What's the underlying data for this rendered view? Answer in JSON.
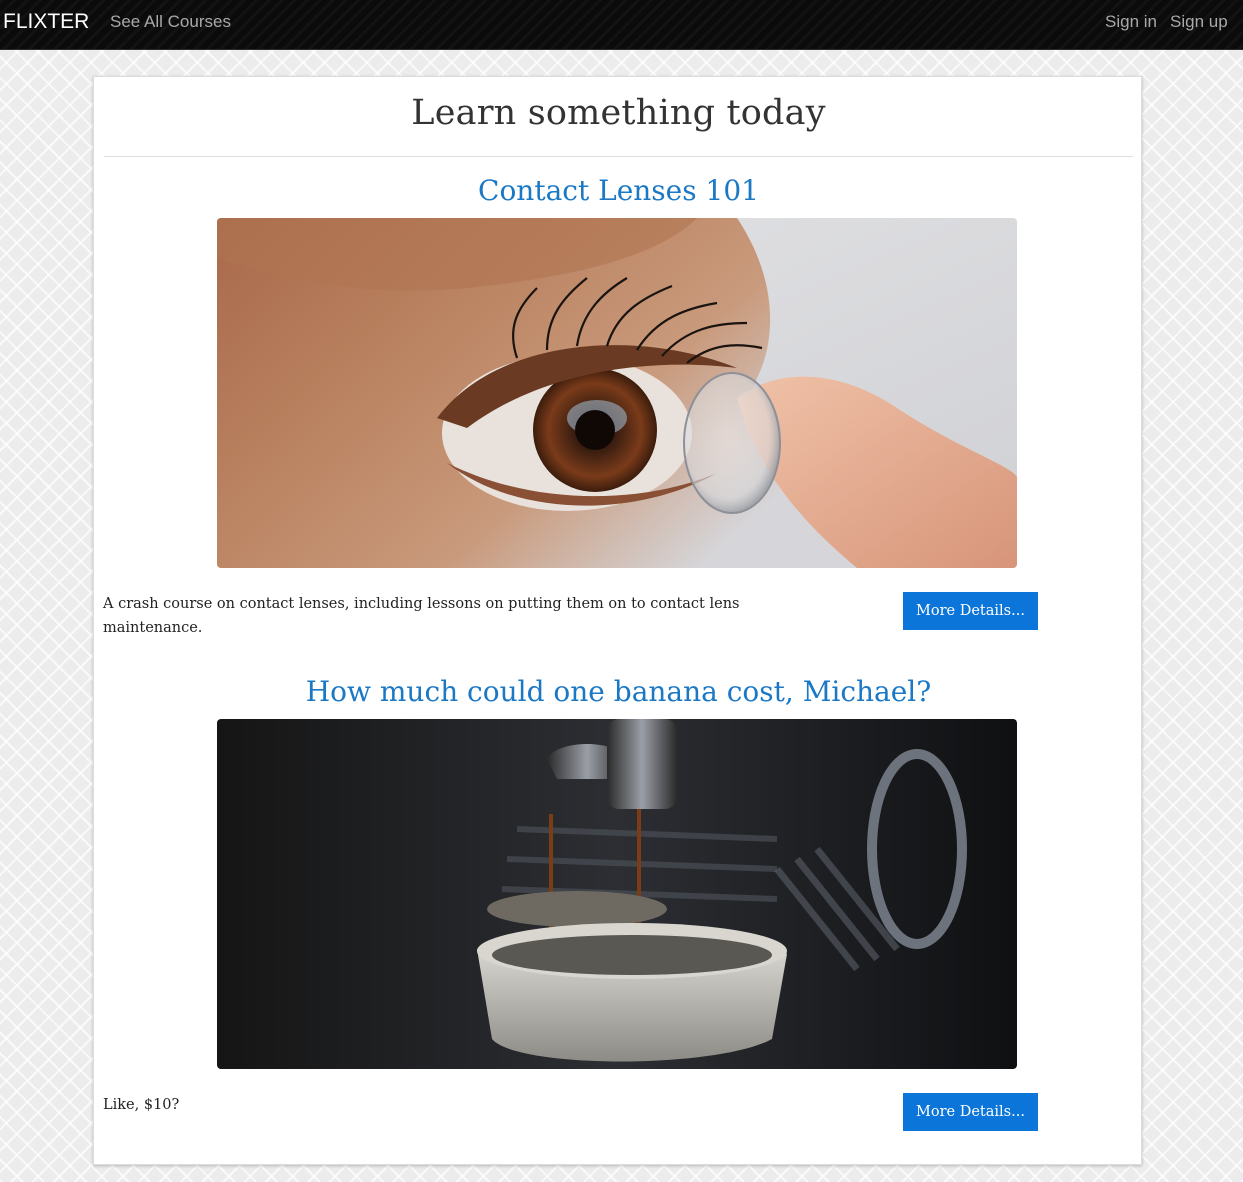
{
  "navbar": {
    "brand": "FLIXTER",
    "courses_link": "See All Courses",
    "sign_in": "Sign in",
    "sign_up": "Sign up"
  },
  "main": {
    "title": "Learn something today",
    "courses": [
      {
        "title": "Contact Lenses 101",
        "image_subject": "eye-with-contact-lens",
        "description": "A crash course on contact lenses, including lessons on putting them on to contact lens maintenance.",
        "button_label": "More Details..."
      },
      {
        "title": "How much could one banana cost, Michael?",
        "image_subject": "espresso-machine-pouring-coffee",
        "description": "Like, $10?",
        "button_label": "More Details..."
      }
    ]
  },
  "colors": {
    "navbar_bg": "#0b0b0b",
    "course_title": "#1b78c5",
    "button_bg": "#0b75d9",
    "card_bg": "#ffffff"
  }
}
